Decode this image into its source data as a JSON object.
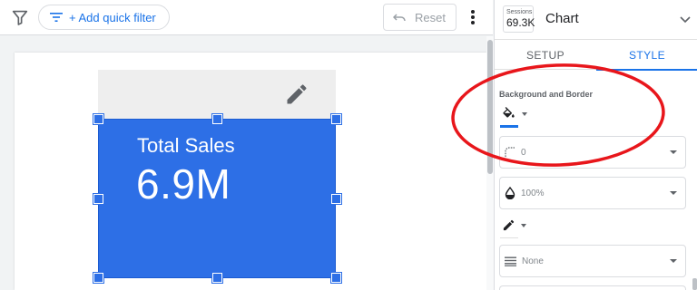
{
  "toolbar": {
    "filter_icon": "filter-icon",
    "quick_filter_label": "+ Add quick filter",
    "reset_label": "Reset",
    "more_icon": "more-vert-icon"
  },
  "scorecard": {
    "label": "Total Sales",
    "value": "6.9M",
    "color": "#2d6fe6"
  },
  "panel": {
    "metric_chip": {
      "label": "Sessions",
      "value": "69.3K"
    },
    "title": "Chart",
    "tabs": [
      {
        "label": "SETUP",
        "active": false
      },
      {
        "label": "STYLE",
        "active": true
      }
    ],
    "section_title": "Background and Border",
    "fill_color": "#1a73e8",
    "border_color": "#ffffff",
    "fields": {
      "corner_radius": "0",
      "opacity": "100%",
      "border_style": "None"
    }
  },
  "annotation": {
    "color": "#e8161b",
    "shape": "ellipse"
  },
  "colors": {
    "accent": "#1a73e8",
    "canvas_bg": "#f1f3f4"
  }
}
